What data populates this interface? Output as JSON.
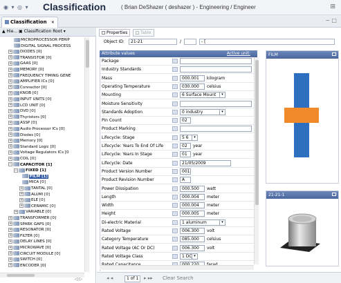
{
  "topbar": {
    "nav": "◉ ▾ ◎ ▾",
    "title": "Classification",
    "subtitle": "( Brian DeShazer ( deshazer ) - Engineering / Engineer",
    "corner": "⊞"
  },
  "tabbar": {
    "tab_label": "Classification",
    "close": "✕",
    "window_controls": "− □"
  },
  "left": {
    "header": "▲ Hie... ▣ Classification Root ▾",
    "items": [
      {
        "indent": 18,
        "exp": "",
        "label": "MICROPROCESSOR PERIP"
      },
      {
        "indent": 18,
        "exp": "",
        "label": "DIGITAL SIGNAL PROCESS"
      },
      {
        "indent": 10,
        "exp": "+",
        "label": "DIODES [0]"
      },
      {
        "indent": 10,
        "exp": "+",
        "label": "TRANSISTOR [0]"
      },
      {
        "indent": 10,
        "exp": "+",
        "label": "GAAS [0]"
      },
      {
        "indent": 10,
        "exp": "+",
        "label": "MEMORY [0]"
      },
      {
        "indent": 10,
        "exp": "+",
        "label": "FREQUENCY TIMING GENE"
      },
      {
        "indent": 10,
        "exp": "+",
        "label": "AMPLIFIER ICs [0]"
      },
      {
        "indent": 10,
        "exp": "+",
        "label": "Connector [0]"
      },
      {
        "indent": 10,
        "exp": "+",
        "label": "KNOB [0]"
      },
      {
        "indent": 10,
        "exp": "+",
        "label": "INPUT UNITS [0]"
      },
      {
        "indent": 10,
        "exp": "+",
        "label": "LCD UNIT [0]"
      },
      {
        "indent": 10,
        "exp": "+",
        "label": "DVD [0]"
      },
      {
        "indent": 10,
        "exp": "+",
        "label": "Thyristors [0]"
      },
      {
        "indent": 10,
        "exp": "+",
        "label": "ASSP [0]"
      },
      {
        "indent": 10,
        "exp": "+",
        "label": "Audio Processor ICs [0]"
      },
      {
        "indent": 10,
        "exp": "+",
        "label": "Diodes [0]"
      },
      {
        "indent": 10,
        "exp": "+",
        "label": "Memory [0]"
      },
      {
        "indent": 10,
        "exp": "+",
        "label": "Standard Logic [0]"
      },
      {
        "indent": 10,
        "exp": "+",
        "label": "Voltage Regulators ICs [0"
      },
      {
        "indent": 10,
        "exp": "+",
        "label": "COIL [0]"
      },
      {
        "indent": 10,
        "exp": "−",
        "label": "CAPACITOR [1]",
        "bold": true
      },
      {
        "indent": 18,
        "exp": "−",
        "label": "FIXED [1]",
        "bold": true
      },
      {
        "indent": 30,
        "exp": "",
        "label": "FILM [1]",
        "bold": true,
        "selected": true
      },
      {
        "indent": 30,
        "exp": "",
        "label": "MICA [0]"
      },
      {
        "indent": 26,
        "exp": "+",
        "label": "TANTAL [0]"
      },
      {
        "indent": 26,
        "exp": "+",
        "label": "ALUMI [0]"
      },
      {
        "indent": 26,
        "exp": "+",
        "label": "ELE [0]"
      },
      {
        "indent": 26,
        "exp": "+",
        "label": "CERAMIC [0]"
      },
      {
        "indent": 18,
        "exp": "+",
        "label": "VARIABLE [0]"
      },
      {
        "indent": 10,
        "exp": "+",
        "label": "TRANSFORMER [0]"
      },
      {
        "indent": 10,
        "exp": "+",
        "label": "SPARK GAPS [0]"
      },
      {
        "indent": 10,
        "exp": "+",
        "label": "RESONATOR [0]"
      },
      {
        "indent": 10,
        "exp": "+",
        "label": "FILTER [0]"
      },
      {
        "indent": 10,
        "exp": "+",
        "label": "DELAY LINES [0]"
      },
      {
        "indent": 10,
        "exp": "+",
        "label": "MICROWAVE [0]"
      },
      {
        "indent": 10,
        "exp": "+",
        "label": "CIRCUIT MODULE [0]"
      },
      {
        "indent": 10,
        "exp": "+",
        "label": "SWITCH [0]"
      },
      {
        "indent": 10,
        "exp": "+",
        "label": "ENCODER [0]"
      }
    ],
    "nav_buttons": "◁ ▷"
  },
  "main": {
    "tab_properties": "Properties",
    "tab_table": "Table",
    "object_id_label": "Object ID:",
    "object_id_value": "21-21",
    "slash": "/",
    "object_id_suffix": "- [",
    "attr_header": "Attribute values",
    "active_unit": "Active unit:",
    "rows": [
      {
        "k": "Package",
        "v": "",
        "u": ""
      },
      {
        "k": "Industry Standards",
        "v": "",
        "u": ""
      },
      {
        "k": "Mass",
        "v": "000.001",
        "u": "kilogram"
      },
      {
        "k": "Operating Temperature",
        "v": "030.000",
        "u": "celsius"
      },
      {
        "k": "Mounting",
        "v": "6 Surface Mount",
        "u": "",
        "dd": true
      },
      {
        "k": "Moisture Sensitivity",
        "v": "",
        "u": ""
      },
      {
        "k": "Standards Adoption",
        "v": "0 industry",
        "u": "",
        "dd": true
      },
      {
        "k": "Pin Count",
        "v": "02",
        "u": ""
      },
      {
        "k": "Product Marking",
        "v": "",
        "u": ""
      },
      {
        "k": "Lifecycle: Stage",
        "v": "5 6",
        "u": "",
        "dd": true
      },
      {
        "k": "Lifecycle: Years To End Of Life",
        "v": "02",
        "u": "year"
      },
      {
        "k": "Lifecycle: Years In Stage",
        "v": "01",
        "u": "year"
      },
      {
        "k": "Lifecycle: Date",
        "v": "21/05/2009",
        "u": ""
      },
      {
        "k": "Product Version Number",
        "v": "001",
        "u": ""
      },
      {
        "k": "Product Revision Number",
        "v": "A",
        "u": ""
      },
      {
        "k": "Power Dissipation",
        "v": "000.500",
        "u": "watt"
      },
      {
        "k": "Length",
        "v": "000.004",
        "u": "meter"
      },
      {
        "k": "Width",
        "v": "000.004",
        "u": "meter"
      },
      {
        "k": "Height",
        "v": "000.005",
        "u": "meter"
      },
      {
        "k": "Di-electric Material",
        "v": "1 aluminum",
        "u": "",
        "dd": true
      },
      {
        "k": "Rated Voltage",
        "v": "006.300",
        "u": "volt"
      },
      {
        "k": "Category Temperature",
        "v": "085.000",
        "u": "celsius"
      },
      {
        "k": "Rated Voltage (AC Or DC)",
        "v": "006.300",
        "u": "volt"
      },
      {
        "k": "Rated Voltage Class",
        "v": "1 DC",
        "u": "",
        "dd": true
      },
      {
        "k": "Rated Capacitance",
        "v": "000.220",
        "u": "farad"
      }
    ],
    "page_label": "1 of 1",
    "pager_left": "◂ ◂",
    "pager_right": "▸ ▸▸",
    "toolbar_tail": "Clear  Search"
  },
  "right": {
    "film_title": "FILM",
    "part_title": "21-21-1"
  },
  "colors": {
    "accent": "#4a679f",
    "selection": "#2b55a0",
    "film_blue": "#2f6fc0",
    "film_orange": "#f08a2a"
  }
}
